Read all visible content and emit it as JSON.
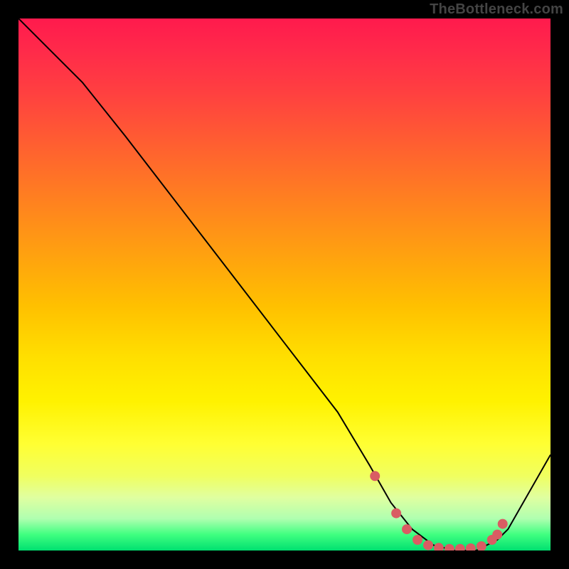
{
  "attribution": "TheBottleneck.com",
  "colors": {
    "marker": "#d95c63",
    "curve": "#000000"
  },
  "chart_data": {
    "type": "line",
    "title": "",
    "xlabel": "",
    "ylabel": "",
    "xlim": [
      0,
      100
    ],
    "ylim": [
      0,
      100
    ],
    "grid": false,
    "legend": false,
    "series": [
      {
        "name": "curve",
        "x": [
          0,
          6,
          12,
          20,
          30,
          40,
          50,
          60,
          66,
          70,
          74,
          78,
          82,
          86,
          90,
          92,
          100
        ],
        "y": [
          100,
          94,
          88,
          78,
          65,
          52,
          39,
          26,
          16,
          9,
          4,
          1,
          0,
          0,
          2,
          4,
          18
        ]
      }
    ],
    "markers": {
      "name": "highlighted-points",
      "x": [
        67,
        71,
        73,
        75,
        77,
        79,
        81,
        83,
        85,
        87,
        89,
        90,
        91
      ],
      "y": [
        14,
        7,
        4,
        2,
        1,
        0.5,
        0.3,
        0.3,
        0.4,
        0.8,
        2,
        3,
        5
      ]
    }
  }
}
